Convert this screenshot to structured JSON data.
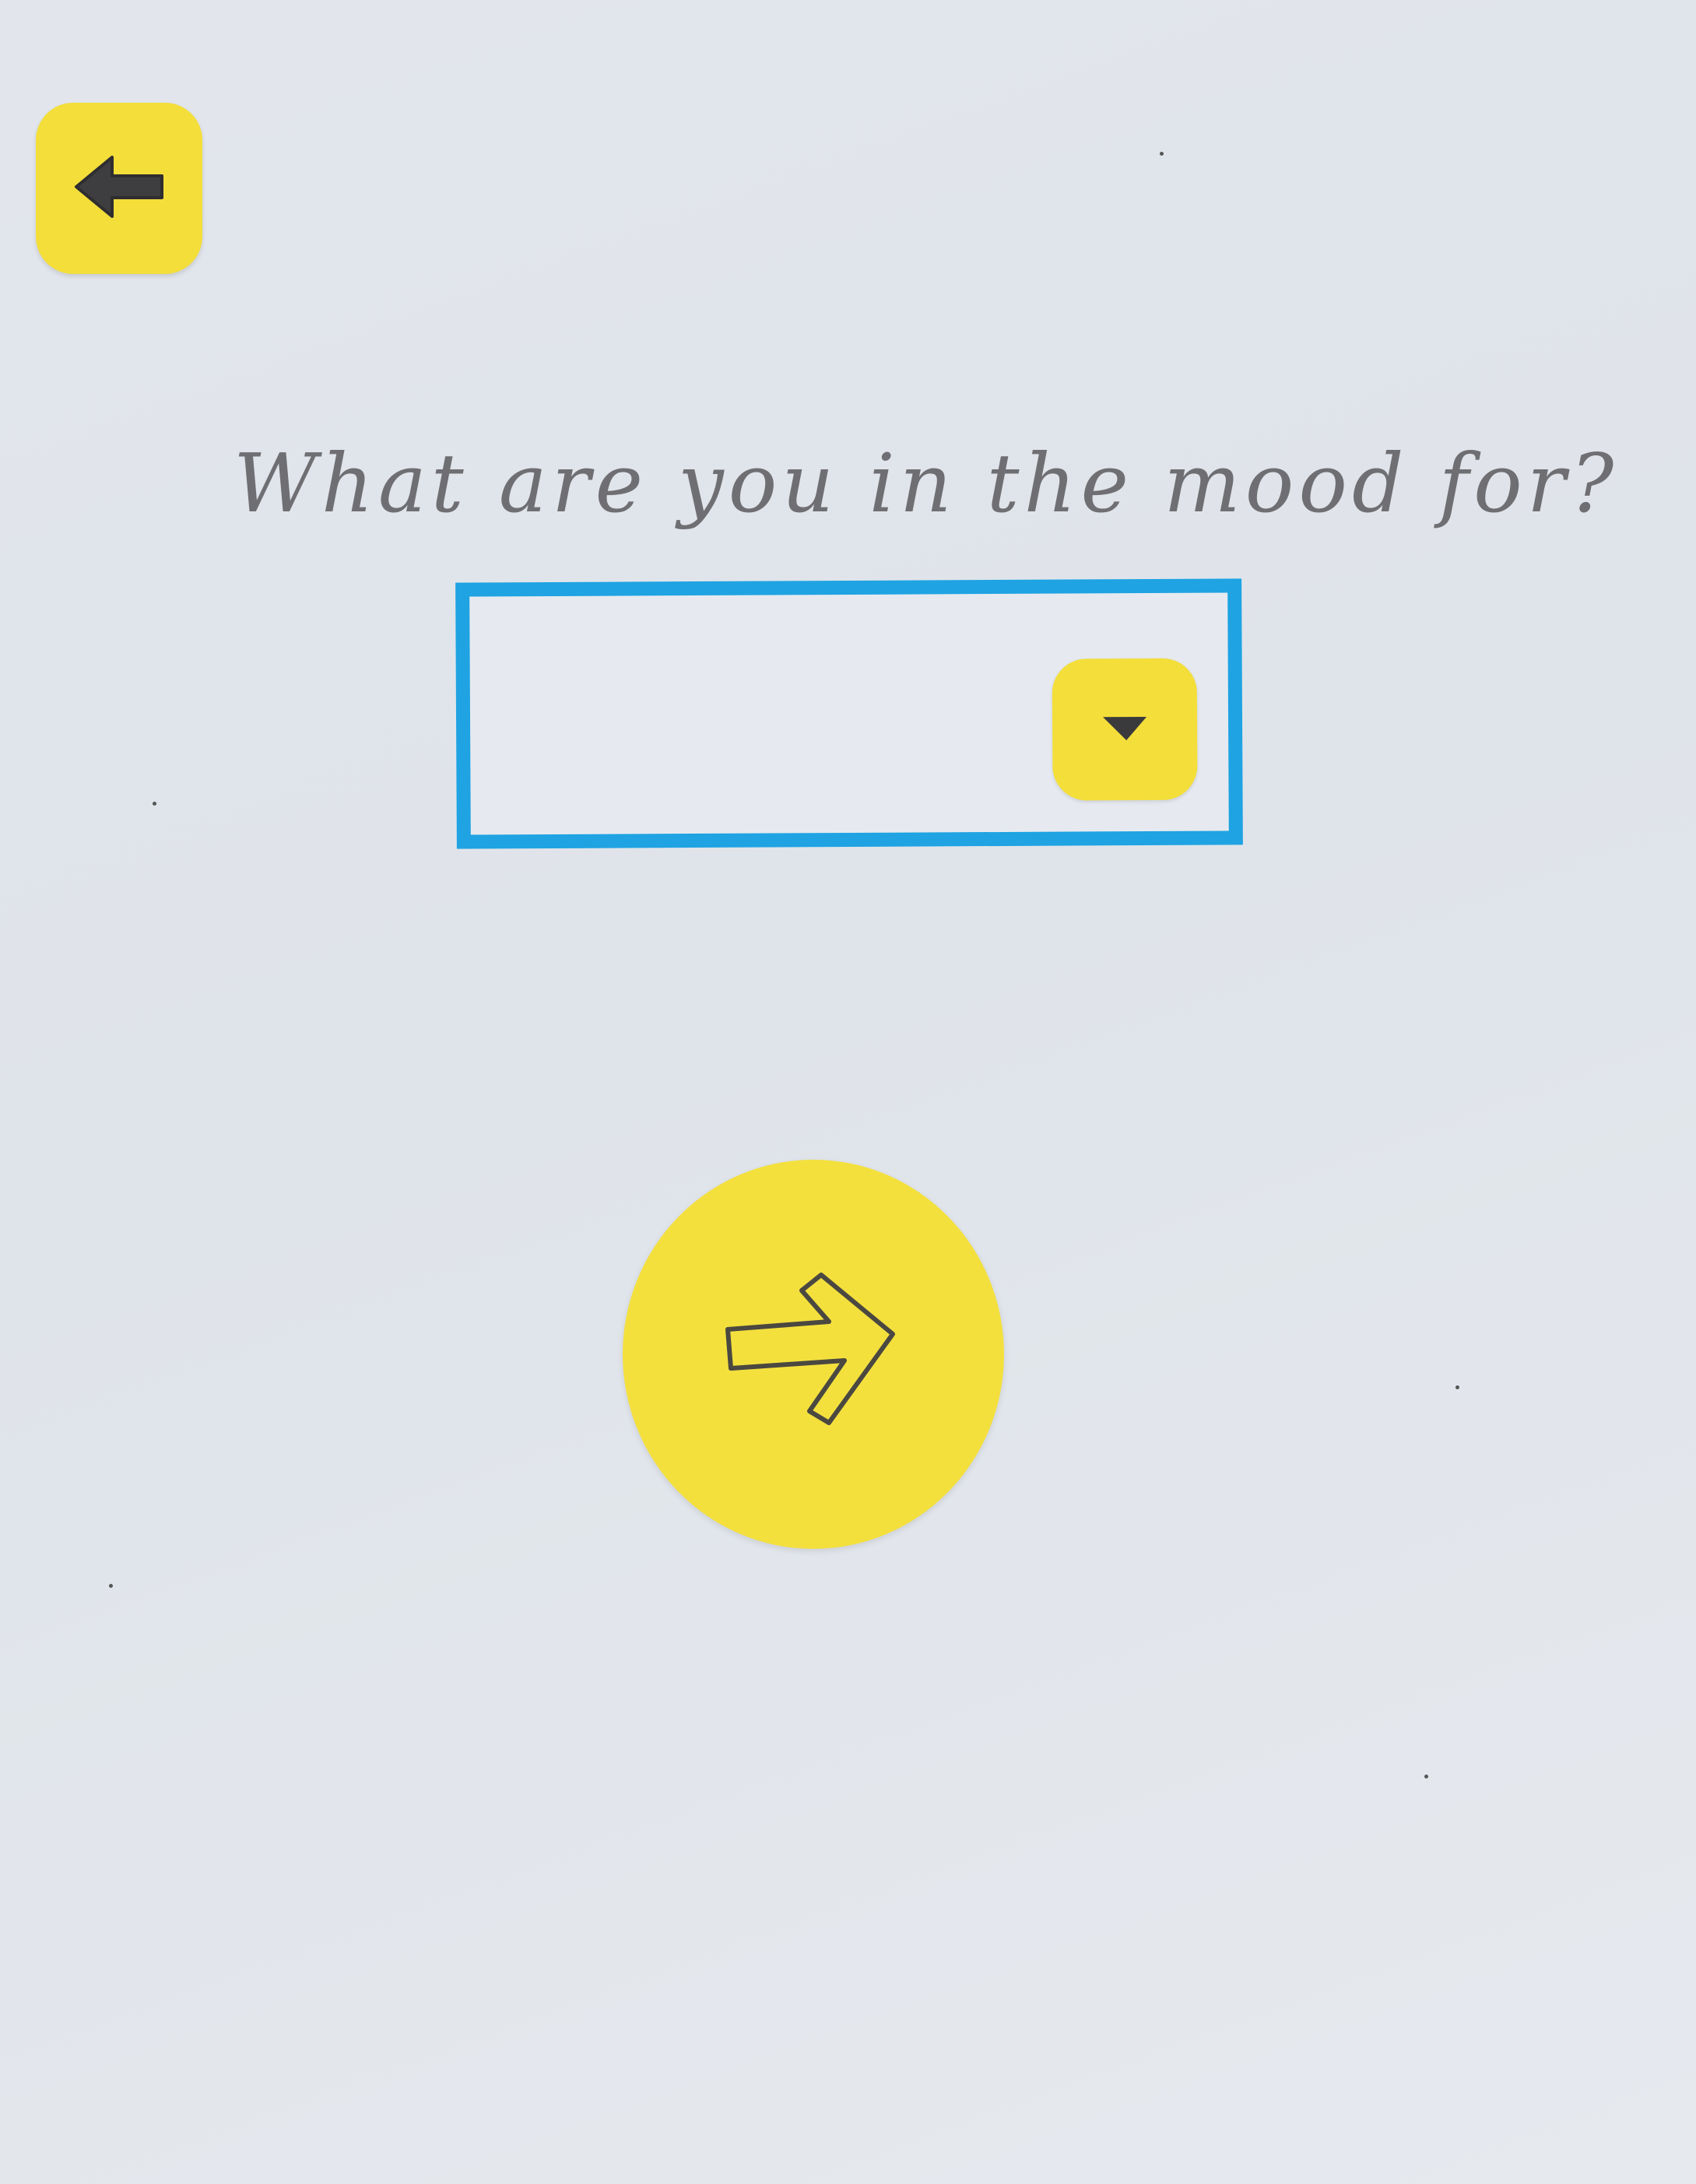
{
  "screen": {
    "question": "What are you in the mood for?"
  },
  "back_button": {
    "icon": "arrow-left-icon"
  },
  "mood_select": {
    "selected_value": "",
    "toggle_icon": "caret-down-icon"
  },
  "next_button": {
    "icon": "arrow-right-icon"
  },
  "colors": {
    "button_yellow": "#f4de3a",
    "select_border": "#1fa3e2",
    "background": "#e2e6ec",
    "question_text": "#6f6f73"
  }
}
